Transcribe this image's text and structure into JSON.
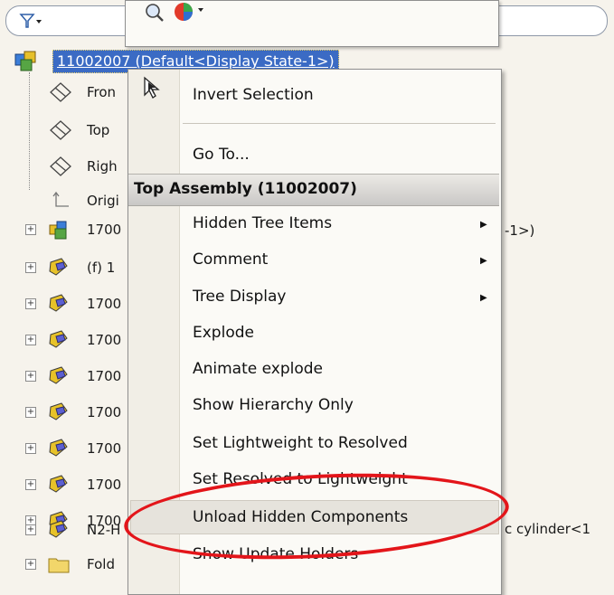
{
  "toolbar": {
    "filter_icon": "filter-funnel-icon"
  },
  "tree": {
    "root_label": "11002007  (Default<Display State-1>)",
    "items": [
      {
        "label": "Fron",
        "icon": "plane-icon"
      },
      {
        "label": "Top",
        "icon": "plane-icon"
      },
      {
        "label": "Righ",
        "icon": "plane-icon"
      },
      {
        "label": "Origi",
        "icon": "origin-icon"
      },
      {
        "label": "1700",
        "icon": "assembly-icon"
      },
      {
        "label": "(f) 1",
        "icon": "part-icon"
      },
      {
        "label": "1700",
        "icon": "part-icon"
      },
      {
        "label": "1700",
        "icon": "part-icon"
      },
      {
        "label": "1700",
        "icon": "part-icon"
      },
      {
        "label": "1700",
        "icon": "part-icon"
      },
      {
        "label": "1700",
        "icon": "part-icon"
      },
      {
        "label": "1700",
        "icon": "part-icon"
      },
      {
        "label": "1700",
        "icon": "part-icon"
      },
      {
        "label": "N2-H",
        "icon": "part-icon"
      },
      {
        "label": "Fold",
        "icon": "folder-icon"
      }
    ],
    "tail_texts": {
      "row5": "-1>)",
      "row13": "c cylinder<1"
    }
  },
  "context_menu": {
    "invert_selection": "Invert Selection",
    "go_to": "Go To...",
    "header": "Top Assembly (11002007)",
    "items": [
      "Hidden Tree Items",
      "Comment",
      "Tree Display",
      "Explode",
      "Animate explode",
      "Show Hierarchy Only",
      "Set Lightweight to Resolved",
      "Set Resolved to Lightweight",
      "Unload Hidden Components",
      "Show Update Holders"
    ]
  },
  "annotation": {
    "color": "#e3151a"
  }
}
